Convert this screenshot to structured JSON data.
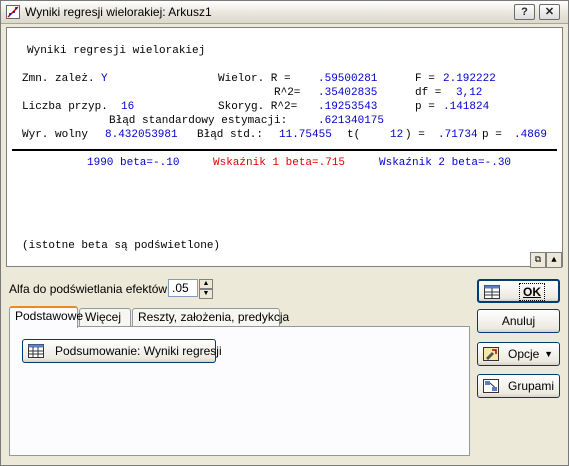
{
  "window": {
    "title": "Wyniki regresji wielorakiej: Arkusz1",
    "help": "?",
    "close": "✕"
  },
  "report": {
    "heading": "Wyniki regresji wielorakiej",
    "dep_label": "Zmn. zależ.",
    "dep_value": "Y",
    "wielor_label": "Wielor. R = ",
    "wielor_value": ".59500281",
    "f_label": "F = ",
    "f_value": "2.192222",
    "r2_label": "R^2= ",
    "r2_value": ".35402835",
    "df_label": "df = ",
    "df_value": "3,12",
    "n_label": "Liczba przyp.",
    "n_value": "16",
    "skoryg_label": "Skoryg. R^2= ",
    "skoryg_value": ".19253543",
    "p_label": "p = ",
    "p_value": ".141824",
    "se_label": "Błąd standardowy estymacji:",
    "se_value": ".621340175",
    "intercept_label": "Wyr. wolny",
    "intercept_value": "8.432053981",
    "bstd_label": "Błąd std.:",
    "bstd_value": "11.75455",
    "t_label": "t(",
    "t_df": "12",
    "t_mid": ") =",
    "t_value": ".71734",
    "p2_label": "p =",
    "p2_value": ".4869",
    "beta1": "1990 beta=-.10",
    "beta2": "Wskaźnik 1 beta=.715",
    "beta3": "Wskaźnik 2 beta=-.30",
    "note": "(istotne beta są podświetlone)"
  },
  "alpha": {
    "label": "Alfa do podświetlania efektów:",
    "value": ".05"
  },
  "tabs": [
    {
      "label": "Podstawowe"
    },
    {
      "label": "Więcej"
    },
    {
      "label": "Reszty, założenia, predykcja"
    }
  ],
  "buttons": {
    "summary": "Podsumowanie:  Wyniki regresji",
    "ok": "OK",
    "cancel": "Anuluj",
    "options": "Opcje",
    "groups": "Grupami"
  },
  "colors": {
    "highlight": "#e00000",
    "value_blue": "#0000cc",
    "tab_accent": "#e68b2c"
  }
}
